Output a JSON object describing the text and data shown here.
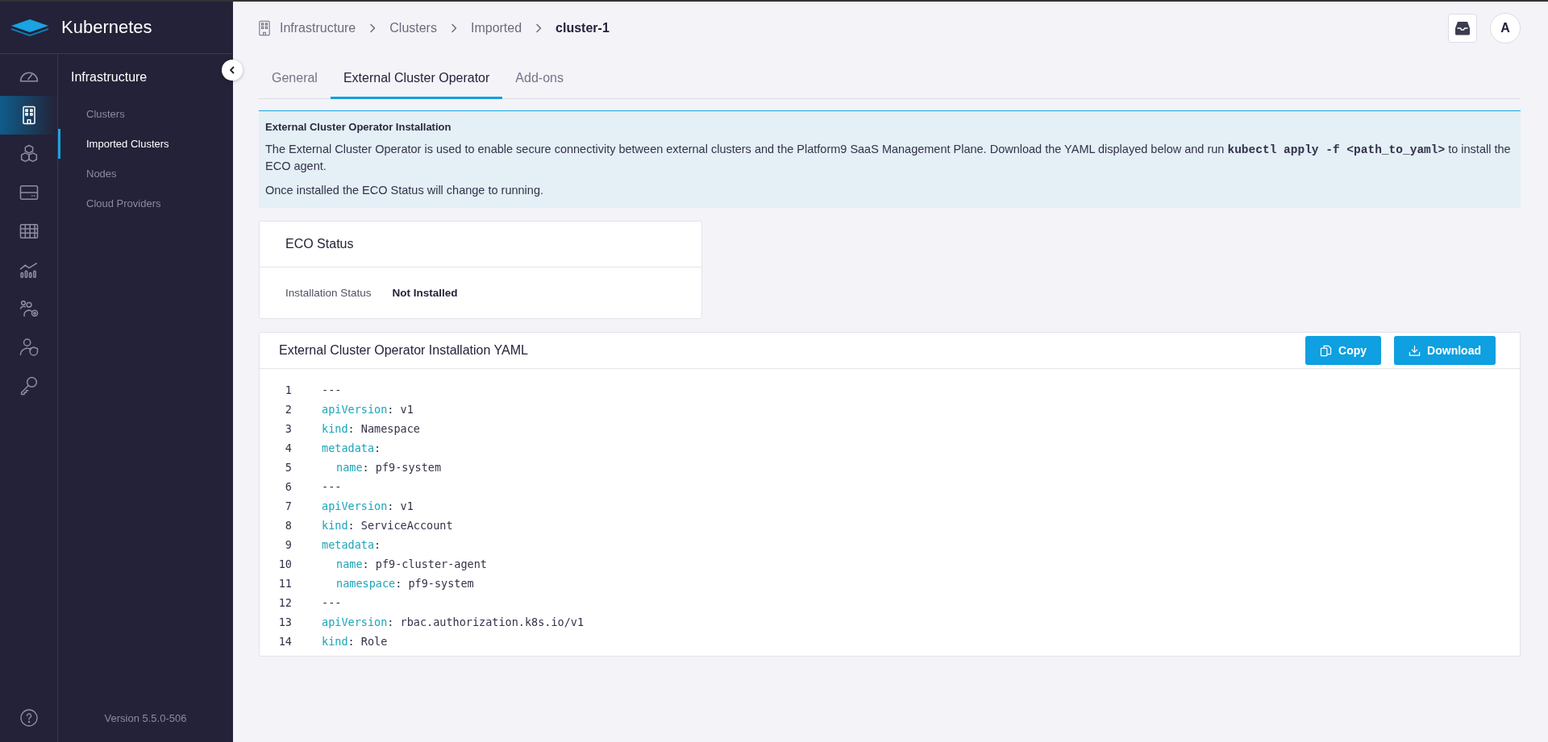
{
  "app": {
    "title": "Kubernetes",
    "version": "Version 5.5.0-506"
  },
  "rail": [
    {
      "selected": false
    },
    {
      "selected": true
    },
    {
      "selected": false
    },
    {
      "selected": false
    },
    {
      "selected": false
    },
    {
      "selected": false
    },
    {
      "selected": false
    },
    {
      "selected": false
    },
    {
      "selected": false
    }
  ],
  "nav": {
    "title": "Infrastructure",
    "items": [
      {
        "label": "Clusters",
        "selected": false
      },
      {
        "label": "Imported Clusters",
        "selected": true
      },
      {
        "label": "Nodes",
        "selected": false
      },
      {
        "label": "Cloud Providers",
        "selected": false
      }
    ]
  },
  "breadcrumb": [
    {
      "label": "Infrastructure",
      "current": false
    },
    {
      "label": "Clusters",
      "current": false
    },
    {
      "label": "Imported",
      "current": false
    },
    {
      "label": "cluster-1",
      "current": true
    }
  ],
  "avatar": "A",
  "tabs": [
    {
      "label": "General",
      "selected": false
    },
    {
      "label": "External Cluster Operator",
      "selected": true
    },
    {
      "label": "Add-ons",
      "selected": false
    }
  ],
  "notice": {
    "title": "External Cluster Operator Installation",
    "text_before": "The External Cluster Operator is used to enable secure connectivity between external clusters and the Platform9 SaaS Management Plane. Download the YAML displayed below and run ",
    "command": "kubectl apply -f <path_to_yaml>",
    "text_after": " to install the ECO agent.",
    "note": "Once installed the ECO Status will change to running."
  },
  "eco_status": {
    "title": "ECO Status",
    "fields": [
      {
        "label": "Installation Status",
        "value": "Not Installed"
      }
    ]
  },
  "yaml": {
    "title": "External Cluster Operator Installation YAML",
    "buttons": [
      {
        "label": "Copy",
        "kind": "copy"
      },
      {
        "label": "Download",
        "kind": "download"
      }
    ],
    "lines": [
      {
        "number": "1",
        "text": "---"
      },
      {
        "number": "2",
        "key": "apiVersion",
        "rest": ": v1",
        "nested": false
      },
      {
        "number": "3",
        "key": "kind",
        "rest": ": Namespace",
        "nested": false
      },
      {
        "number": "4",
        "key": "metadata",
        "rest": ":",
        "nested": false
      },
      {
        "number": "5",
        "key": "name",
        "rest": ": pf9-system",
        "nested": true
      },
      {
        "number": "6",
        "text": "---"
      },
      {
        "number": "7",
        "key": "apiVersion",
        "rest": ": v1",
        "nested": false
      },
      {
        "number": "8",
        "key": "kind",
        "rest": ": ServiceAccount",
        "nested": false
      },
      {
        "number": "9",
        "key": "metadata",
        "rest": ":",
        "nested": false
      },
      {
        "number": "10",
        "key": "name",
        "rest": ": pf9-cluster-agent",
        "nested": true
      },
      {
        "number": "11",
        "key": "namespace",
        "rest": ": pf9-system",
        "nested": true
      },
      {
        "number": "12",
        "text": "---"
      },
      {
        "number": "13",
        "key": "apiVersion",
        "rest": ": rbac.authorization.k8s.io/v1",
        "nested": false
      },
      {
        "number": "14",
        "key": "kind",
        "rest": ": Role",
        "nested": false
      }
    ]
  }
}
